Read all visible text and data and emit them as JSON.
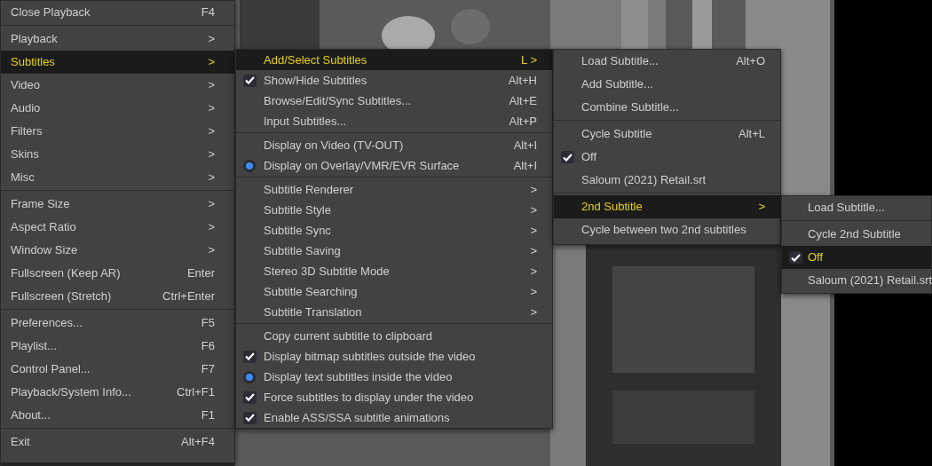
{
  "menus": [
    {
      "items": [
        {
          "kind": "item",
          "label": "Close Playback",
          "shortcut": "F4",
          "selected": false
        },
        {
          "kind": "separator"
        },
        {
          "kind": "item",
          "label": "Playback",
          "shortcut": ">",
          "selected": false
        },
        {
          "kind": "item",
          "label": "Subtitles",
          "shortcut": ">",
          "selected": true
        },
        {
          "kind": "item",
          "label": "Video",
          "shortcut": ">",
          "selected": false
        },
        {
          "kind": "item",
          "label": "Audio",
          "shortcut": ">",
          "selected": false
        },
        {
          "kind": "item",
          "label": "Filters",
          "shortcut": ">",
          "selected": false
        },
        {
          "kind": "item",
          "label": "Skins",
          "shortcut": ">",
          "selected": false
        },
        {
          "kind": "item",
          "label": "Misc",
          "shortcut": ">",
          "selected": false
        },
        {
          "kind": "separator"
        },
        {
          "kind": "item",
          "label": "Frame Size",
          "shortcut": ">",
          "selected": false
        },
        {
          "kind": "item",
          "label": "Aspect Ratio",
          "shortcut": ">",
          "selected": false
        },
        {
          "kind": "item",
          "label": "Window Size",
          "shortcut": ">",
          "selected": false
        },
        {
          "kind": "item",
          "label": "Fullscreen (Keep AR)",
          "shortcut": "Enter",
          "selected": false
        },
        {
          "kind": "item",
          "label": "Fullscreen (Stretch)",
          "shortcut": "Ctrl+Enter",
          "selected": false
        },
        {
          "kind": "separator"
        },
        {
          "kind": "item",
          "label": "Preferences...",
          "shortcut": "F5",
          "selected": false
        },
        {
          "kind": "item",
          "label": "Playlist...",
          "shortcut": "F6",
          "selected": false
        },
        {
          "kind": "item",
          "label": "Control Panel...",
          "shortcut": "F7",
          "selected": false
        },
        {
          "kind": "item",
          "label": "Playback/System Info...",
          "shortcut": "Ctrl+F1",
          "selected": false
        },
        {
          "kind": "item",
          "label": "About...",
          "shortcut": "F1",
          "selected": false
        },
        {
          "kind": "separator"
        },
        {
          "kind": "item",
          "label": "Exit",
          "shortcut": "Alt+F4",
          "selected": false
        }
      ]
    },
    {
      "items": [
        {
          "kind": "item",
          "label": "Add/Select Subtitles",
          "shortcut": "L >",
          "selected": true
        },
        {
          "kind": "check",
          "label": "Show/Hide Subtitles",
          "shortcut": "Alt+H",
          "selected": false,
          "checked": true
        },
        {
          "kind": "item",
          "label": "Browse/Edit/Sync Subtitles...",
          "shortcut": "Alt+E",
          "selected": false
        },
        {
          "kind": "item",
          "label": "Input Subtitles...",
          "shortcut": "Alt+P",
          "selected": false
        },
        {
          "kind": "separator"
        },
        {
          "kind": "radio",
          "label": "Display on Video (TV-OUT)",
          "shortcut": "Alt+I",
          "selected": false,
          "checked": false
        },
        {
          "kind": "radio",
          "label": "Display on Overlay/VMR/EVR Surface",
          "shortcut": "Alt+I",
          "selected": false,
          "checked": true
        },
        {
          "kind": "separator"
        },
        {
          "kind": "item",
          "label": "Subtitle Renderer",
          "shortcut": ">",
          "selected": false
        },
        {
          "kind": "item",
          "label": "Subtitle Style",
          "shortcut": ">",
          "selected": false
        },
        {
          "kind": "item",
          "label": "Subtitle Sync",
          "shortcut": ">",
          "selected": false
        },
        {
          "kind": "item",
          "label": "Subtitle Saving",
          "shortcut": ">",
          "selected": false
        },
        {
          "kind": "item",
          "label": "Stereo 3D Subtitle Mode",
          "shortcut": ">",
          "selected": false
        },
        {
          "kind": "item",
          "label": "Subtitle Searching",
          "shortcut": ">",
          "selected": false
        },
        {
          "kind": "item",
          "label": "Subtitle Translation",
          "shortcut": ">",
          "selected": false
        },
        {
          "kind": "separator"
        },
        {
          "kind": "item",
          "label": "Copy current subtitle to clipboard",
          "selected": false
        },
        {
          "kind": "check",
          "label": "Display bitmap subtitles outside the video",
          "selected": false,
          "checked": true
        },
        {
          "kind": "radio",
          "label": "Display text subtitles inside the video",
          "selected": false,
          "checked": true
        },
        {
          "kind": "check",
          "label": "Force subtitles to display under the video",
          "selected": false,
          "checked": true
        },
        {
          "kind": "check",
          "label": "Enable ASS/SSA subtitle animations",
          "selected": false,
          "checked": true
        }
      ]
    },
    {
      "items": [
        {
          "kind": "item",
          "label": "Load Subtitle...",
          "shortcut": "Alt+O",
          "selected": false
        },
        {
          "kind": "item",
          "label": "Add Subtitle...",
          "selected": false
        },
        {
          "kind": "item",
          "label": "Combine Subtitle...",
          "selected": false
        },
        {
          "kind": "separator"
        },
        {
          "kind": "item",
          "label": "Cycle Subtitle",
          "shortcut": "Alt+L",
          "selected": false
        },
        {
          "kind": "check",
          "label": "Off",
          "selected": false,
          "checked": true
        },
        {
          "kind": "check",
          "label": "Saloum (2021) Retail.srt",
          "selected": false,
          "checked": false
        },
        {
          "kind": "separator"
        },
        {
          "kind": "item",
          "label": "2nd Subtitle",
          "shortcut": ">",
          "selected": true
        },
        {
          "kind": "item",
          "label": "Cycle between two 2nd subtitles",
          "selected": false
        }
      ]
    },
    {
      "items": [
        {
          "kind": "item",
          "label": "Load Subtitle...",
          "selected": false
        },
        {
          "kind": "separator"
        },
        {
          "kind": "item",
          "label": "Cycle 2nd Subtitle",
          "selected": false
        },
        {
          "kind": "check",
          "label": "Off",
          "selected": true,
          "checked": true
        },
        {
          "kind": "check",
          "label": "Saloum (2021) Retail.srt",
          "selected": false,
          "checked": false
        }
      ]
    }
  ]
}
